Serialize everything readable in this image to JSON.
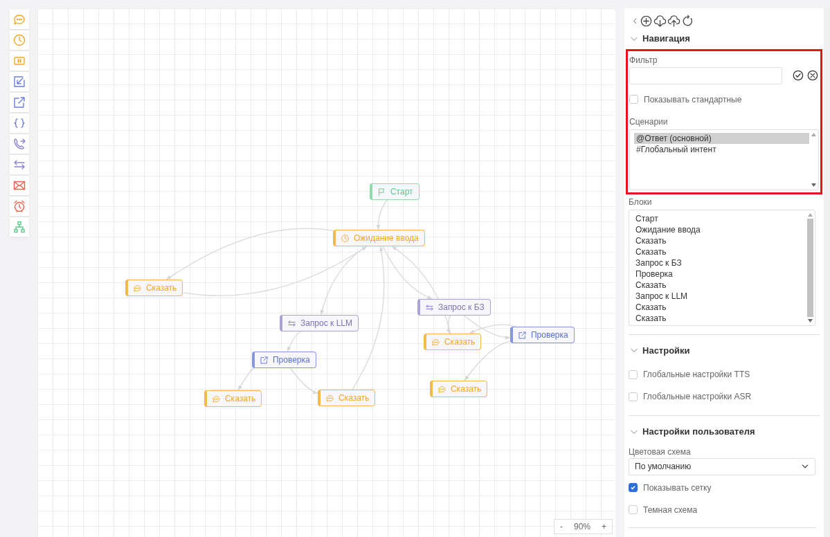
{
  "toolbar": [
    {
      "kind": "say"
    },
    {
      "kind": "wait"
    },
    {
      "kind": "pause"
    },
    {
      "kind": "input"
    },
    {
      "kind": "check"
    },
    {
      "kind": "code"
    },
    {
      "kind": "transfer"
    },
    {
      "kind": "request"
    },
    {
      "kind": "email"
    },
    {
      "kind": "timer"
    },
    {
      "kind": "hierarchy"
    }
  ],
  "canvas": {
    "nodes": [
      {
        "kind": "start",
        "label": "Старт"
      },
      {
        "kind": "wait",
        "label": "Ожидание ввода"
      },
      {
        "kind": "say",
        "label": "Сказать"
      },
      {
        "kind": "request",
        "label": "Запрос к LLM"
      },
      {
        "kind": "check",
        "label": "Проверка"
      },
      {
        "kind": "say",
        "label": "Сказать"
      },
      {
        "kind": "say",
        "label": "Сказать"
      },
      {
        "kind": "request",
        "label": "Запрос к БЗ"
      },
      {
        "kind": "say",
        "label": "Сказать"
      },
      {
        "kind": "check",
        "label": "Проверка"
      },
      {
        "kind": "say",
        "label": "Сказать"
      }
    ],
    "zoom": {
      "minus": "-",
      "value": "90%",
      "plus": "+"
    }
  },
  "panel": {
    "navigation": {
      "title": "Навигация",
      "expanded": true,
      "highlighted": true,
      "filter_label": "Фильтр",
      "show_standard": {
        "label": "Показывать стандартные",
        "checked": false
      },
      "scenarios": {
        "label": "Сценарии",
        "items": [
          {
            "text": "@Ответ (основной)",
            "selected": true
          },
          {
            "text": "#Глобальный интент",
            "selected": false
          }
        ]
      },
      "blocks": {
        "label": "Блоки",
        "items": [
          {
            "text": "Старт",
            "selected": false
          },
          {
            "text": "Ожидание ввода",
            "selected": false
          },
          {
            "text": "Сказать",
            "selected": false
          },
          {
            "text": "Сказать",
            "selected": false
          },
          {
            "text": "Запрос к БЗ",
            "selected": false
          },
          {
            "text": "Проверка",
            "selected": false
          },
          {
            "text": "Сказать",
            "selected": false
          },
          {
            "text": "Запрос к LLM",
            "selected": false
          },
          {
            "text": "Сказать",
            "selected": false
          },
          {
            "text": "Сказать",
            "selected": false
          }
        ]
      }
    },
    "settings": {
      "title": "Настройки",
      "expanded": true,
      "options": [
        {
          "label": "Глобальные настройки TTS",
          "checked": false
        },
        {
          "label": "Глобальные настройки ASR",
          "checked": false
        }
      ]
    },
    "user_settings": {
      "title": "Настройки пользователя",
      "expanded": true,
      "color_scheme": {
        "label": "Цветовая схема",
        "value": "По умолчанию"
      },
      "options": [
        {
          "label": "Показывать сетку",
          "checked": true
        },
        {
          "label": "Темная схема",
          "checked": false
        }
      ]
    }
  }
}
